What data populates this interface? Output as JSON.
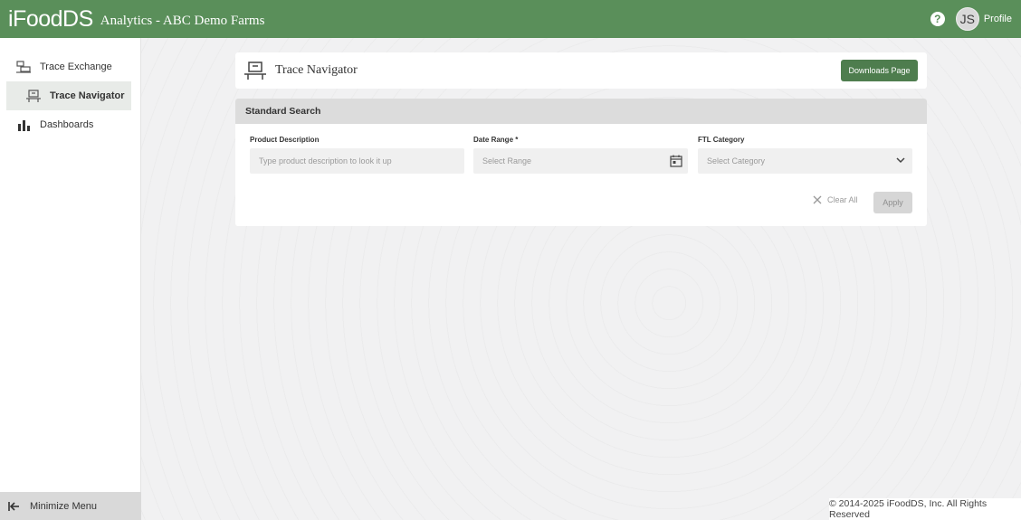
{
  "header": {
    "logo": "iFoodDS",
    "app_title": "Analytics - ABC Demo Farms",
    "help_label": "?",
    "avatar_initials": "JS",
    "profile_label": "Profile"
  },
  "sidebar": {
    "items": [
      {
        "label": "Trace Exchange",
        "icon": "trace-exchange-icon",
        "active": false
      },
      {
        "label": "Trace Navigator",
        "icon": "trace-navigator-icon",
        "active": true
      },
      {
        "label": "Dashboards",
        "icon": "bar-chart-icon",
        "active": false
      }
    ],
    "minimize_label": "Minimize Menu"
  },
  "page": {
    "title": "Trace Navigator",
    "downloads_label": "Downloads Page"
  },
  "search": {
    "title": "Standard Search",
    "product": {
      "label": "Product Description",
      "placeholder": "Type product description to look it up"
    },
    "date": {
      "label": "Date Range *",
      "placeholder": "Select Range"
    },
    "category": {
      "label": "FTL Category",
      "placeholder": "Select Category"
    },
    "clear_label": "Clear All",
    "apply_label": "Apply"
  },
  "footer": {
    "copyright": "© 2014-2025 iFoodDS, Inc. All Rights Reserved"
  },
  "colors": {
    "brand": "#5a8f5a",
    "button": "#4e7d4e"
  }
}
